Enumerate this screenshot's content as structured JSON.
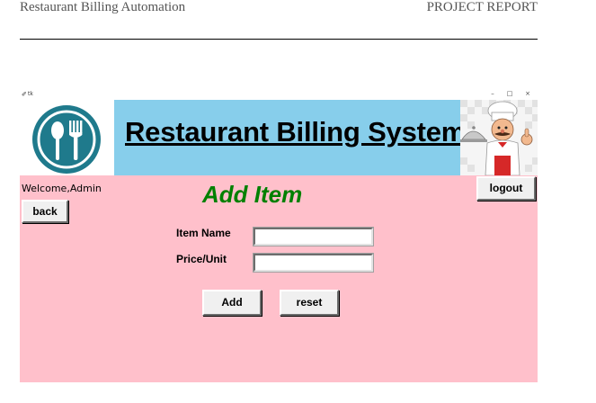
{
  "document": {
    "header_left": "Restaurant Billing Automation",
    "header_right": "PROJECT REPORT"
  },
  "window": {
    "title": "tk",
    "feather_icon": "feather-icon",
    "controls": [
      "–",
      "□",
      "×"
    ]
  },
  "banner": {
    "title": "Restaurant Billing System",
    "logo_icon": "fork-spoon-logo-icon",
    "mascot_icon": "chef-mascot-icon",
    "colors": {
      "banner_bg": "#87ceeb",
      "logo_teal": "#1f7a8c"
    }
  },
  "session": {
    "welcome_text": "Welcome,Admin",
    "back_label": "back",
    "logout_label": "logout"
  },
  "form": {
    "heading": "Add Item",
    "item_name_label": "Item Name",
    "item_name_value": "",
    "price_label": "Price/Unit",
    "price_value": "",
    "add_label": "Add",
    "reset_label": "reset"
  },
  "colors": {
    "page_bg": "#ffc0cb",
    "heading": "#008000"
  }
}
